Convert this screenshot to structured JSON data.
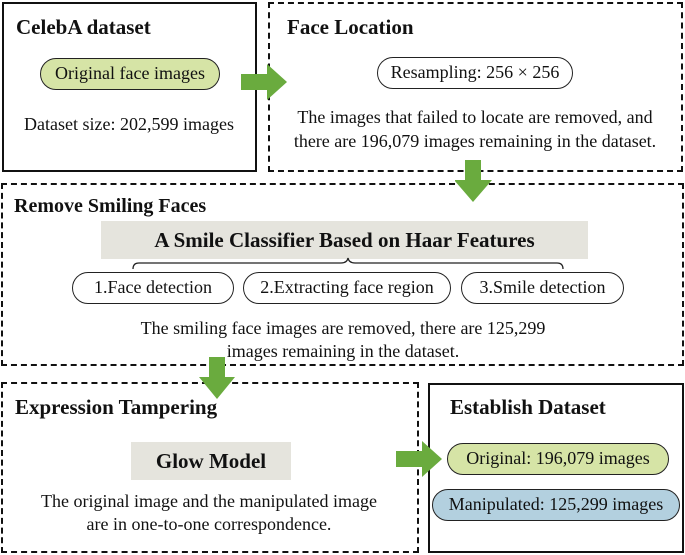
{
  "colors": {
    "arrow": "#6aab3e",
    "green_pill": "#d6e4a6",
    "blue_pill": "#b3d0df",
    "banner": "#e5e4dd",
    "border": "#111111"
  },
  "celeba": {
    "title": "CelebA dataset",
    "pill": "Original face images",
    "size_text": "Dataset size: 202,599 images"
  },
  "face_location": {
    "title": "Face Location",
    "pill": "Resampling: 256 × 256",
    "line1": "The images that failed to locate are removed, and",
    "line2": "there are 196,079 images remaining in the dataset."
  },
  "remove_smiling": {
    "title": "Remove Smiling Faces",
    "banner": "A Smile Classifier Based on Haar Features",
    "steps": [
      "1.Face detection",
      "2.Extracting face region",
      "3.Smile detection"
    ],
    "line1": "The smiling face images are removed, there are 125,299",
    "line2": "images remaining in the dataset."
  },
  "expression_tampering": {
    "title": "Expression Tampering",
    "banner": "Glow Model",
    "line1": "The original image and the manipulated image",
    "line2": "are in one-to-one correspondence."
  },
  "establish": {
    "title": "Establish Dataset",
    "original": "Original: 196,079 images",
    "manipulated": "Manipulated: 125,299 images"
  },
  "arrows": [
    "arrow-right",
    "arrow-down",
    "arrow-down",
    "arrow-right"
  ]
}
